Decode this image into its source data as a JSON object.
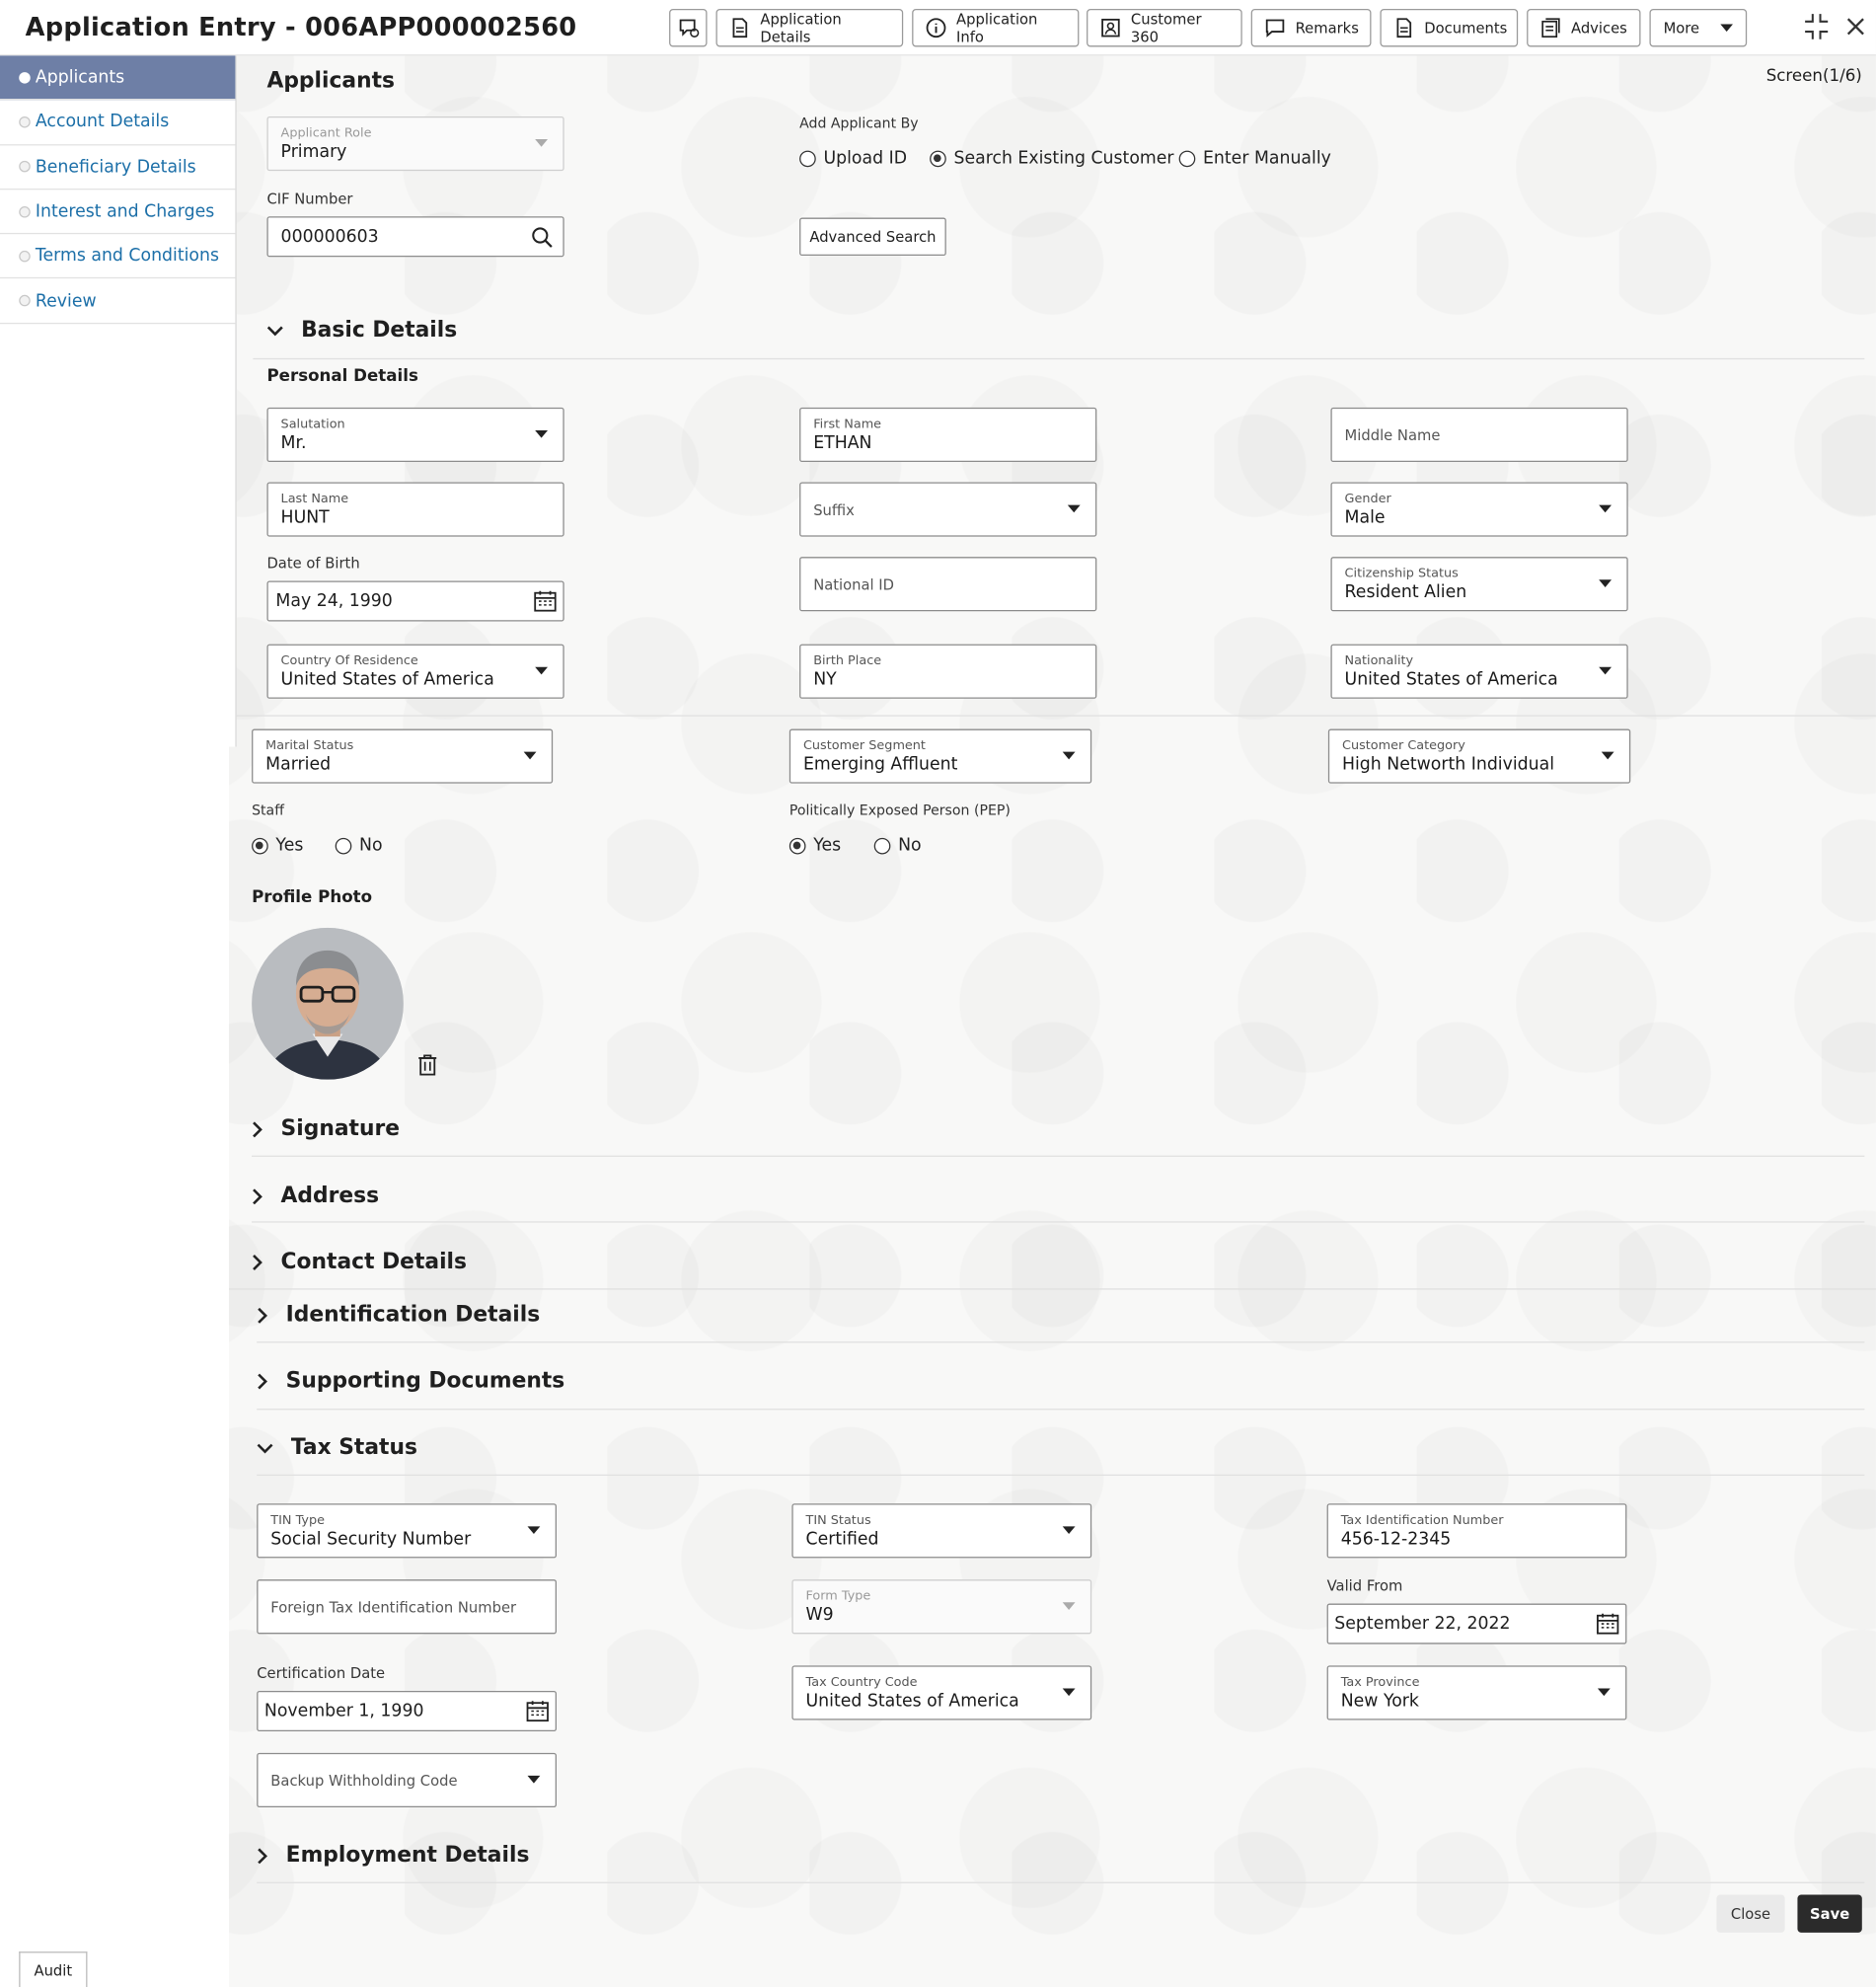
{
  "header": {
    "title": "Application Entry - 006APP000002560",
    "buttons": {
      "application_details": "Application Details",
      "application_info": "Application Info",
      "customer_360": "Customer 360",
      "remarks": "Remarks",
      "documents": "Documents",
      "advices": "Advices",
      "more": "More"
    }
  },
  "sidebar": {
    "items": [
      {
        "label": "Applicants"
      },
      {
        "label": "Account Details"
      },
      {
        "label": "Beneficiary Details"
      },
      {
        "label": "Interest and Charges"
      },
      {
        "label": "Terms and Conditions"
      },
      {
        "label": "Review"
      }
    ]
  },
  "main": {
    "heading": "Applicants",
    "screen_indicator": "Screen(1/6)",
    "applicant_role": {
      "label": "Applicant Role",
      "value": "Primary"
    },
    "add_applicant_by": {
      "label": "Add Applicant By",
      "options": [
        "Upload ID",
        "Search Existing Customer",
        "Enter Manually"
      ],
      "selected": "Search Existing Customer"
    },
    "cif": {
      "label": "CIF Number",
      "value": "000000603"
    },
    "advanced_search": "Advanced Search"
  },
  "basic_details": {
    "title": "Basic Details",
    "personal_details": "Personal Details",
    "salutation": {
      "label": "Salutation",
      "value": "Mr."
    },
    "first_name": {
      "label": "First Name",
      "value": "ETHAN"
    },
    "middle_name": {
      "placeholder": "Middle Name"
    },
    "last_name": {
      "label": "Last Name",
      "value": "HUNT"
    },
    "suffix": {
      "placeholder": "Suffix"
    },
    "gender": {
      "label": "Gender",
      "value": "Male"
    },
    "dob": {
      "label": "Date of Birth",
      "value": "May 24, 1990"
    },
    "national_id": {
      "placeholder": "National ID"
    },
    "citizenship": {
      "label": "Citizenship Status",
      "value": "Resident Alien"
    },
    "country_residence": {
      "label": "Country Of Residence",
      "value": "United States of America"
    },
    "birth_place": {
      "label": "Birth Place",
      "value": "NY"
    },
    "nationality": {
      "label": "Nationality",
      "value": "United States of America"
    },
    "marital_status": {
      "label": "Marital Status",
      "value": "Married"
    },
    "customer_segment": {
      "label": "Customer Segment",
      "value": "Emerging Affluent"
    },
    "customer_category": {
      "label": "Customer Category",
      "value": "High Networth Individual"
    },
    "staff": {
      "label": "Staff",
      "yes": "Yes",
      "no": "No",
      "selected": "Yes"
    },
    "pep": {
      "label": "Politically Exposed Person (PEP)",
      "yes": "Yes",
      "no": "No",
      "selected": "Yes"
    },
    "profile_photo": "Profile Photo"
  },
  "sections": {
    "signature": "Signature",
    "address": "Address",
    "contact": "Contact Details",
    "identification": "Identification Details",
    "supporting": "Supporting Documents",
    "tax": "Tax Status",
    "employment": "Employment Details"
  },
  "tax_status": {
    "tin_type": {
      "label": "TIN Type",
      "value": "Social Security Number"
    },
    "tin_status": {
      "label": "TIN Status",
      "value": "Certified"
    },
    "tax_id": {
      "label": "Tax Identification Number",
      "value": "456-12-2345"
    },
    "foreign_tin": {
      "placeholder": "Foreign Tax Identification Number"
    },
    "form_type": {
      "label": "Form Type",
      "value": "W9"
    },
    "valid_from": {
      "label": "Valid From",
      "value": "September 22, 2022"
    },
    "certification_date": {
      "label": "Certification Date",
      "value": "November 1, 1990"
    },
    "tax_country": {
      "label": "Tax Country Code",
      "value": "United States of America"
    },
    "tax_province": {
      "label": "Tax Province",
      "value": "New York"
    },
    "backup_withholding": {
      "placeholder": "Backup Withholding Code"
    }
  },
  "footer": {
    "close": "Close",
    "save": "Save",
    "audit": "Audit"
  }
}
